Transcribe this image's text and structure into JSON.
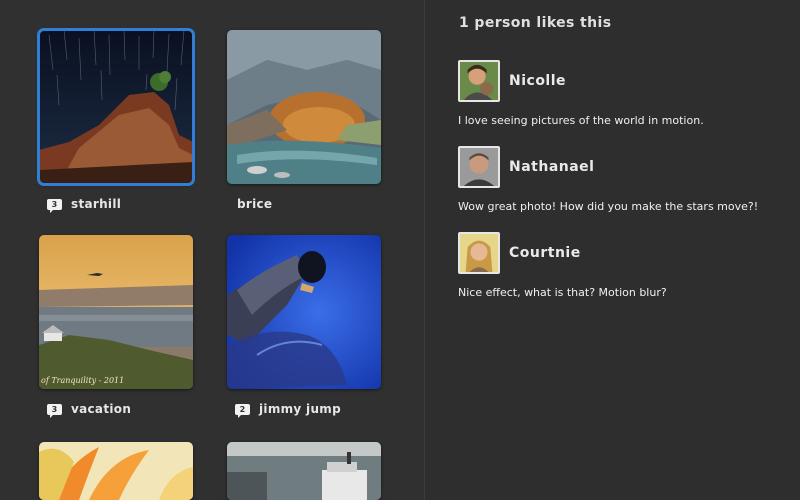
{
  "photos": [
    {
      "name": "starhill",
      "count": "3",
      "selected": true
    },
    {
      "name": "brice",
      "count": null
    },
    {
      "name": "vacation",
      "count": "3",
      "watermark": "of Tranquility - 2011"
    },
    {
      "name": "jimmy jump",
      "count": "2"
    }
  ],
  "likes": {
    "header": "1 person likes this"
  },
  "comments": [
    {
      "name": "Nicolle",
      "text": "I love seeing pictures of the world in motion."
    },
    {
      "name": "Nathanael",
      "text": "Wow great photo! How did you make the stars move?!"
    },
    {
      "name": "Courtnie",
      "text": "Nice effect, what is that? Motion blur?"
    }
  ],
  "colors": {
    "background": "#2e2e2e",
    "selection": "#2f7fd6",
    "text": "#e8e8e8"
  }
}
